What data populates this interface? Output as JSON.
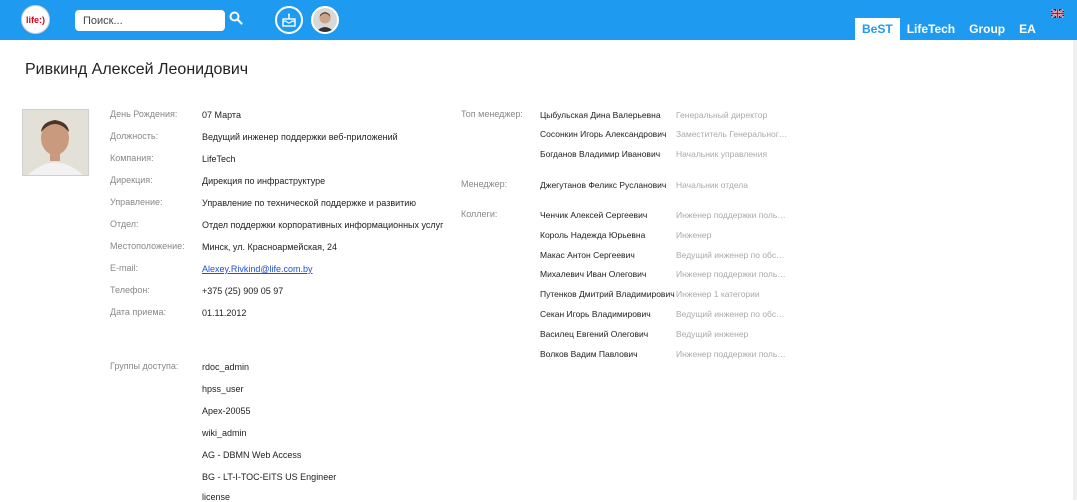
{
  "header": {
    "logo_text": "life:)",
    "search_placeholder": "Поиск...",
    "tabs": [
      {
        "label": "BeST",
        "active": true
      },
      {
        "label": "LifeTech",
        "active": false
      },
      {
        "label": "Group",
        "active": false
      },
      {
        "label": "EA",
        "active": false
      }
    ],
    "accent_color": "#1e9bf0",
    "icons": [
      "search-icon",
      "cake-icon",
      "avatar",
      "uk-flag-icon"
    ]
  },
  "profile": {
    "name": "Ривкинд Алексей Леонидович",
    "fields": [
      {
        "label": "День Рождения:",
        "value": "07 Марта"
      },
      {
        "label": "Должность:",
        "value": "Ведущий инженер поддержки веб-приложений"
      },
      {
        "label": "Компания:",
        "value": "LifeTech"
      },
      {
        "label": "Дирекция:",
        "value": "Дирекция по инфраструктуре"
      },
      {
        "label": "Управление:",
        "value": "Управление по технической поддержке и развитию"
      },
      {
        "label": "Отдел:",
        "value": "Отдел поддержки корпоративных информационных услуг"
      },
      {
        "label": "Местоположение:",
        "value": "Минск, ул. Красноармейская, 24"
      },
      {
        "label": "E-mail:",
        "value": "Alexey.Rivkind@life.com.by"
      },
      {
        "label": "Телефон:",
        "value": "+375 (25) 909 05 97"
      },
      {
        "label": "Дата приема:",
        "value": "01.11.2012"
      }
    ],
    "groups_label": "Группы доступа:",
    "groups": [
      "rdoc_admin",
      "hpss_user",
      "Apex-20055",
      "wiki_admin",
      "AG - DBMN Web Access",
      "BG - LT-I-TOC-EITS US Engineer",
      "license"
    ]
  },
  "org": {
    "top_label": "Топ менеджер:",
    "top": [
      {
        "name": "Цыбульская Дина Валерьевна",
        "position": "Генеральный директор"
      },
      {
        "name": "Сосонкин Игорь Александрович",
        "position": "Заместитель Генерального..."
      },
      {
        "name": "Богданов Владимир Иванович",
        "position": "Начальник управления"
      }
    ],
    "manager_label": "Менеджер:",
    "manager": [
      {
        "name": "Джегутанов Феликс Русланович",
        "position": "Начальник отдела"
      }
    ],
    "colleagues_label": "Коллеги:",
    "colleagues": [
      {
        "name": "Ченчик Алексей Сергеевич",
        "position": "Инженер поддержки пользо..."
      },
      {
        "name": "Король Надежда Юрьевна",
        "position": "Инженер"
      },
      {
        "name": "Макас Антон Сергеевич",
        "position": "Ведущий инженер по обслу..."
      },
      {
        "name": "Михалевич Иван Олегович",
        "position": "Инженер поддержки пользо..."
      },
      {
        "name": "Путенков Дмитрий Владимирович",
        "position": "Инженер 1 категории"
      },
      {
        "name": "Секан Игорь Владимирович",
        "position": "Ведущий инженер по обслу..."
      },
      {
        "name": "Василец Евгений Олегович",
        "position": "Ведущий инженер"
      },
      {
        "name": "Волков Вадим Павлович",
        "position": "Инженер поддержки пользо..."
      }
    ]
  }
}
